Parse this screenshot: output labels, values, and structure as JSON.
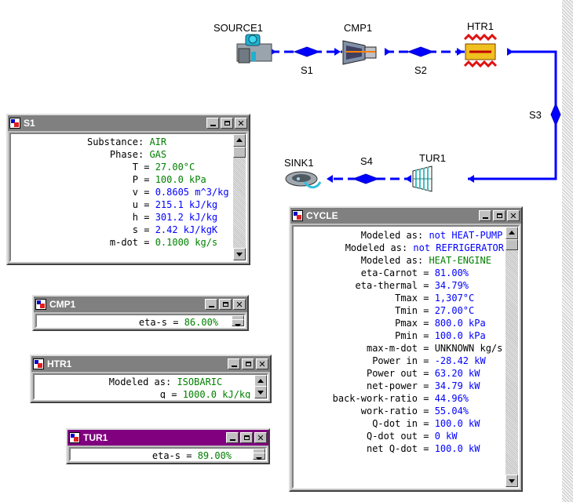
{
  "flowsheet": {
    "components": [
      {
        "id": "SOURCE1"
      },
      {
        "id": "CMP1"
      },
      {
        "id": "HTR1"
      },
      {
        "id": "TUR1"
      },
      {
        "id": "SINK1"
      }
    ],
    "streams": [
      "S1",
      "S2",
      "S3",
      "S4"
    ],
    "connection_color": "#0000ff"
  },
  "windows": {
    "s1": {
      "title": "S1",
      "rows": [
        {
          "label": "Substance",
          "sep": ": ",
          "value": "AIR",
          "color": "green"
        },
        {
          "label": "Phase",
          "sep": ": ",
          "value": "GAS",
          "color": "green"
        },
        {
          "label": "T",
          "sep": " = ",
          "value": "27.00°C",
          "color": "green"
        },
        {
          "label": "P",
          "sep": " = ",
          "value": "100.0 kPa",
          "color": "green"
        },
        {
          "label": "v",
          "sep": " = ",
          "value": "0.8605 m^3/kg",
          "color": "blue"
        },
        {
          "label": "u",
          "sep": " = ",
          "value": "215.1 kJ/kg",
          "color": "blue"
        },
        {
          "label": "h",
          "sep": " = ",
          "value": "301.2 kJ/kg",
          "color": "blue"
        },
        {
          "label": "s",
          "sep": " = ",
          "value": "2.42 kJ/kgK",
          "color": "blue"
        },
        {
          "label": "m-dot",
          "sep": " = ",
          "value": "0.1000 kg/s",
          "color": "green"
        }
      ]
    },
    "cmp1": {
      "title": "CMP1",
      "rows": [
        {
          "label": "eta-s",
          "sep": " = ",
          "value": "86.00%",
          "color": "green"
        }
      ]
    },
    "htr1": {
      "title": "HTR1",
      "rows": [
        {
          "label": "Modeled as",
          "sep": ": ",
          "value": "ISOBARIC",
          "color": "green"
        },
        {
          "label": "q",
          "sep": " = ",
          "value": "1000.0 kJ/kg",
          "color": "green"
        }
      ]
    },
    "tur1": {
      "title": "TUR1",
      "rows": [
        {
          "label": "eta-s",
          "sep": " = ",
          "value": "89.00%",
          "color": "green"
        }
      ]
    },
    "cycle": {
      "title": "CYCLE",
      "rows": [
        {
          "label": "Modeled as",
          "sep": ": ",
          "value": "not HEAT-PUMP",
          "color": "blue"
        },
        {
          "label": "Modeled as",
          "sep": ": ",
          "value": "not REFRIGERATOR",
          "color": "blue"
        },
        {
          "label": "Modeled as",
          "sep": ": ",
          "value": "HEAT-ENGINE",
          "color": "green"
        },
        {
          "label": "eta-Carnot",
          "sep": " = ",
          "value": "81.00%",
          "color": "blue"
        },
        {
          "label": "eta-thermal",
          "sep": " = ",
          "value": "34.79%",
          "color": "blue"
        },
        {
          "label": "Tmax",
          "sep": " = ",
          "value": "1,307°C",
          "color": "blue"
        },
        {
          "label": "Tmin",
          "sep": " = ",
          "value": "27.00°C",
          "color": "blue"
        },
        {
          "label": "Pmax",
          "sep": " = ",
          "value": "800.0 kPa",
          "color": "blue"
        },
        {
          "label": "Pmin",
          "sep": " = ",
          "value": "100.0 kPa",
          "color": "blue"
        },
        {
          "label": "max-m-dot",
          "sep": " = ",
          "value": "UNKNOWN kg/s",
          "color": "black"
        },
        {
          "label": "Power in",
          "sep": " = ",
          "value": "-28.42 kW",
          "color": "blue"
        },
        {
          "label": "Power out",
          "sep": " = ",
          "value": "63.20 kW",
          "color": "blue"
        },
        {
          "label": "net-power",
          "sep": " = ",
          "value": "34.79 kW",
          "color": "blue"
        },
        {
          "label": "back-work-ratio",
          "sep": " = ",
          "value": "44.96%",
          "color": "blue"
        },
        {
          "label": "work-ratio",
          "sep": " = ",
          "value": "55.04%",
          "color": "blue"
        },
        {
          "label": "Q-dot in",
          "sep": " = ",
          "value": "100.0 kW",
          "color": "blue"
        },
        {
          "label": "Q-dot out",
          "sep": " = ",
          "value": "0 kW",
          "color": "blue"
        },
        {
          "label": "net Q-dot",
          "sep": " = ",
          "value": "100.0 kW",
          "color": "blue"
        }
      ]
    }
  }
}
